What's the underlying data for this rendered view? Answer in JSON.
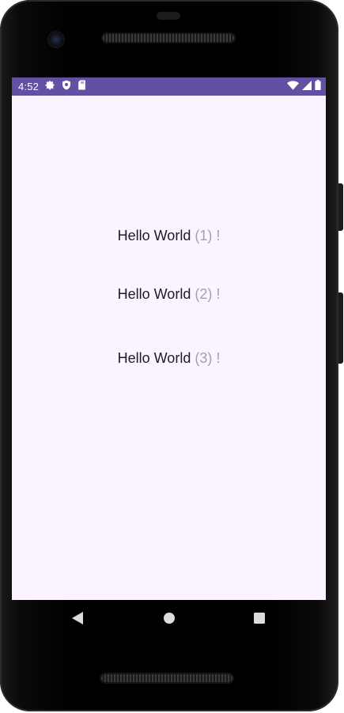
{
  "status_bar": {
    "time": "4:52",
    "background": "#6250a2",
    "left_icons": [
      "settings-icon",
      "shield-icon",
      "sd-card-icon"
    ],
    "right_icons": [
      "wifi-icon",
      "signal-icon",
      "battery-icon"
    ]
  },
  "screen": {
    "background": "#fbf3ff"
  },
  "messages": [
    {
      "text": "Hello World",
      "count": "(1)",
      "suffix": "!"
    },
    {
      "text": "Hello World",
      "count": "(2)",
      "suffix": "!"
    },
    {
      "text": "Hello World",
      "count": "(3)",
      "suffix": "!"
    }
  ],
  "nav_bar": {
    "buttons": [
      "back-icon",
      "home-icon",
      "recents-icon"
    ]
  }
}
